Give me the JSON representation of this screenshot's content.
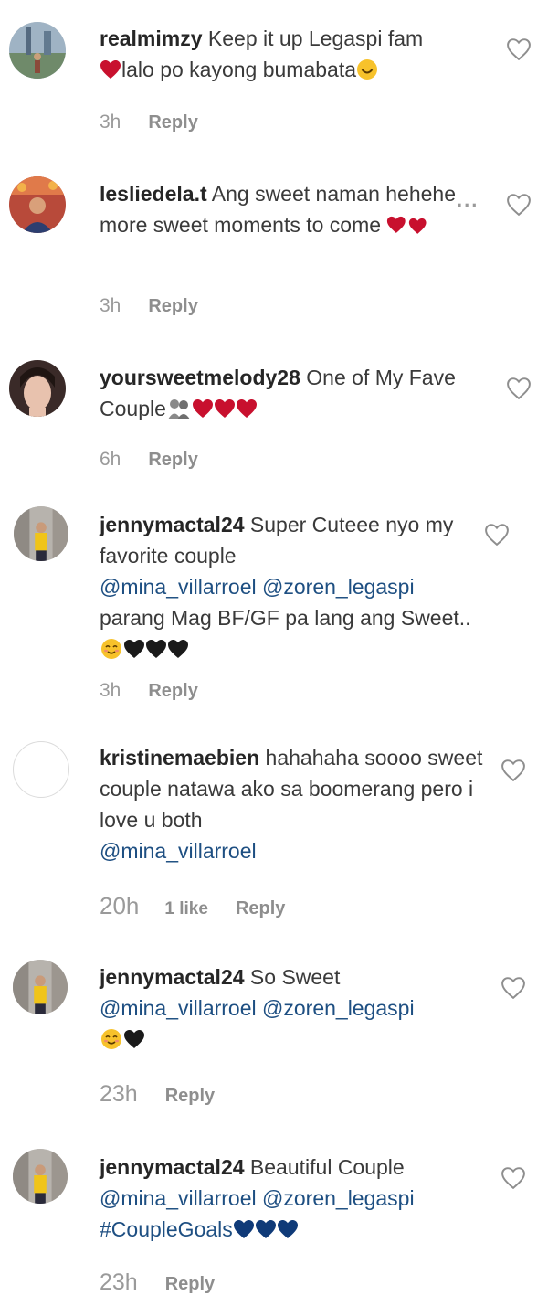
{
  "comments": [
    {
      "username": "realmimzy",
      "text_a": "Keep it up Legaspi fam",
      "text_b": "lalo po kayong bumabata",
      "time": "3h",
      "reply": "Reply"
    },
    {
      "username": "lesliedela.t",
      "text_a": "Ang sweet naman hehehe more sweet moments to come",
      "time": "3h",
      "reply": "Reply",
      "more": "..."
    },
    {
      "username": "yoursweetmelody28",
      "text_a": "One of My Fave Couple",
      "time": "6h",
      "reply": "Reply"
    },
    {
      "username": "jennymactal24",
      "text_a": "Super Cuteee nyo my favorite couple",
      "mention_1": "@mina_villarroel",
      "mention_2": "@zoren_legaspi",
      "text_b": "parang Mag BF/GF pa lang ang Sweet..",
      "time": "3h",
      "reply": "Reply"
    },
    {
      "username": "kristinemaebien",
      "text_a": "hahahaha soooo sweet couple natawa ako sa boomerang pero i love u both",
      "mention_1": "@mina_villarroel",
      "time": "20h",
      "likes": "1 like",
      "reply": "Reply"
    },
    {
      "username": "jennymactal24",
      "text_a": "So Sweet",
      "mention_1": "@mina_villarroel",
      "mention_2": "@zoren_legaspi",
      "time": "23h",
      "reply": "Reply"
    },
    {
      "username": "jennymactal24",
      "text_a": "Beautiful Couple",
      "mention_1": "@mina_villarroel",
      "mention_2": "@zoren_legaspi",
      "hashtag": "#CoupleGoals",
      "time": "23h",
      "reply": "Reply"
    }
  ],
  "icons": {
    "like": "heart-outline-icon",
    "red_heart": "red-heart-emoji",
    "black_heart": "black-heart-emoji",
    "blue_heart": "blue-heart-emoji",
    "smile": "smiling-face-emoji",
    "blush": "blushing-face-emoji",
    "revolving_hearts": "revolving-hearts-emoji",
    "kiss_couple": "couple-silhouette-emoji"
  },
  "colors": {
    "username": "#262626",
    "text": "#3a3a3a",
    "mention": "#1e4f82",
    "meta": "#8e8e8e",
    "red_heart": "#c8102e",
    "black_heart": "#1a1a1a",
    "blue_heart": "#0f3a78",
    "emoji_yellow": "#f7c22b"
  }
}
